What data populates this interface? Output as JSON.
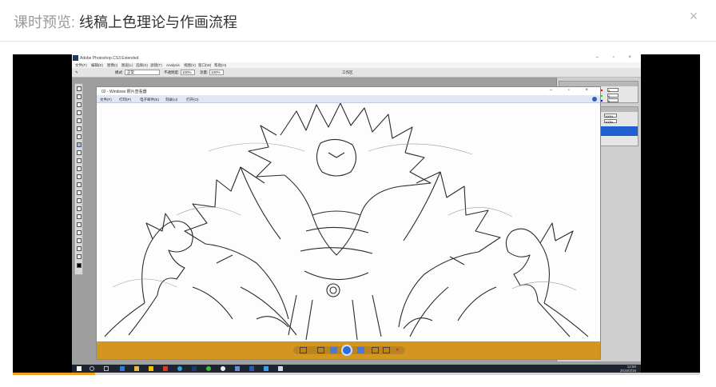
{
  "modal": {
    "title_prefix": "课时预览: ",
    "title_main": "线稿上色理论与作画流程",
    "close_glyph": "×"
  },
  "player": {
    "progress_fraction": 0.12
  },
  "photoshop": {
    "title": "Adobe Photoshop CS3 Extended",
    "menu": [
      "文件(F)",
      "编辑(E)",
      "图像(I)",
      "图层(L)",
      "选择(S)",
      "滤镜(T)",
      "Analysis",
      "视图(V)",
      "窗口(W)",
      "帮助(H)"
    ],
    "options": {
      "mode_label": "模式:",
      "mode_value": "正常",
      "opacity_label": "不透明度:",
      "opacity_value": "100%",
      "flow_label": "流量:",
      "flow_value": "100%",
      "workspace_label": "工作区"
    },
    "panel": {
      "values": [
        "0",
        "0",
        "0"
      ],
      "layer_opacity": "100%",
      "layer_fill": "100%"
    }
  },
  "viewer": {
    "title": "02 - Windows 照片查看器",
    "menu": [
      "文件(F)",
      "打印(P)",
      "电子邮件(E)",
      "刻录(U)",
      "打开(O)"
    ]
  },
  "taskbar": {
    "time": "12:50",
    "date": "2016/3/16"
  },
  "colors": {
    "viewer_bar": "#d4961e",
    "progress": "#f0a020",
    "selected_layer": "#1f5fd0"
  }
}
